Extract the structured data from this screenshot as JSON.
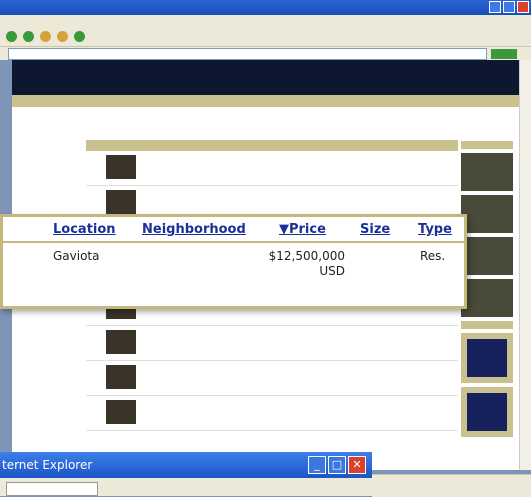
{
  "callout": {
    "columns": {
      "location": "Location",
      "neighborhood": "Neighborhood",
      "price": "▼Price",
      "size": "Size",
      "type": "Type"
    },
    "row": {
      "location": "Gaviota",
      "neighborhood": "",
      "price_line1": "$12,500,000",
      "price_line2": "USD",
      "size": "",
      "type": "Res."
    }
  },
  "ie_window": {
    "title": "ternet Explorer"
  },
  "colors": {
    "callout_border": "#c4b87c",
    "link_blue": "#1b2f9a",
    "site_header": "#0d1830",
    "tan_strip": "#c9c28f"
  }
}
